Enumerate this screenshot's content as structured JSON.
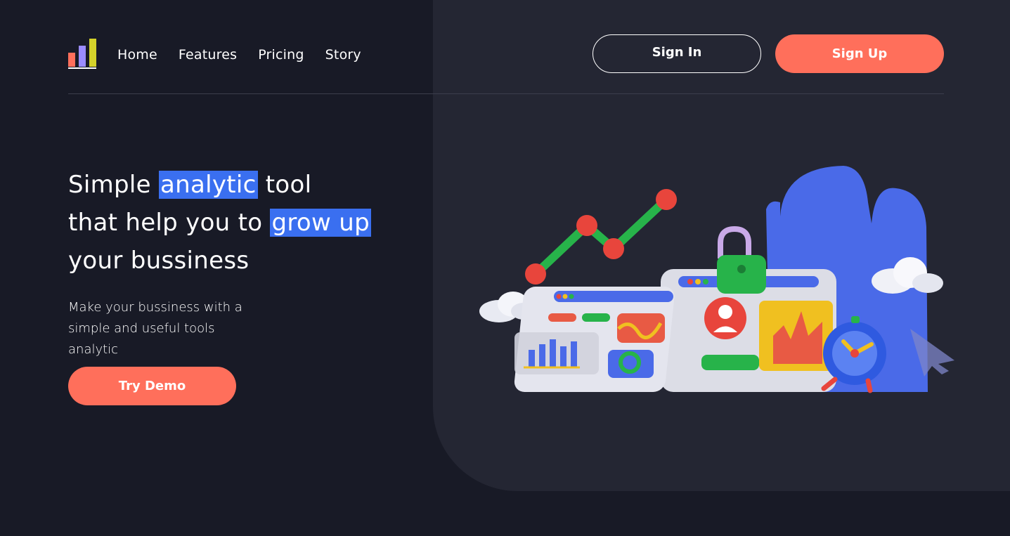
{
  "brand": {
    "logo_icon": "bar-chart-logo-icon",
    "logo_colors": [
      "#ff6f5b",
      "#9b8cff",
      "#d4d22a"
    ]
  },
  "nav": {
    "items": [
      {
        "label": "Home"
      },
      {
        "label": "Features"
      },
      {
        "label": "Pricing"
      },
      {
        "label": "Story"
      }
    ]
  },
  "auth": {
    "sign_in_label": "Sign In",
    "sign_up_label": "Sign Up"
  },
  "hero": {
    "headline_part1": "Simple ",
    "headline_highlight1": "analytic",
    "headline_part2": " tool",
    "headline_part3": "that help you to ",
    "headline_highlight2": "grow up ",
    "headline_part4": "your bussiness",
    "subtext": "Make your bussiness with a simple and useful tools analytic",
    "cta_label": "Try Demo",
    "illustration_icon": "analytics-dashboard-illustration"
  },
  "colors": {
    "background": "#181a26",
    "panel": "#242633",
    "accent": "#ff6f5b",
    "highlight": "#3a6ff0"
  }
}
